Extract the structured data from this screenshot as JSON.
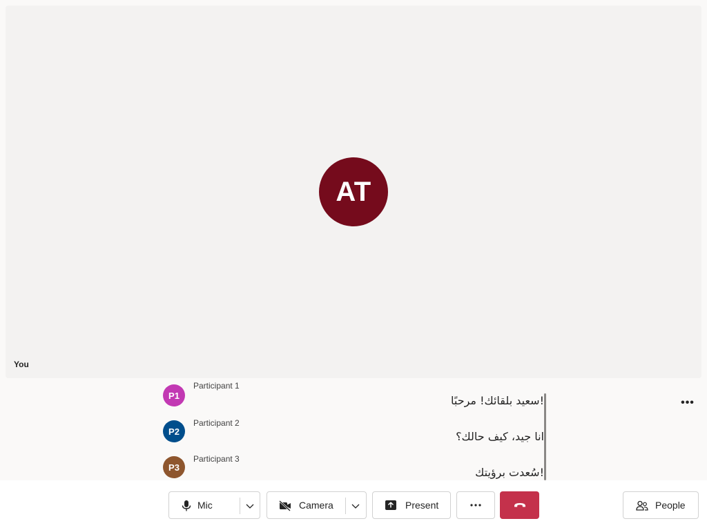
{
  "stage": {
    "avatar_initials": "AT",
    "self_label": "You",
    "avatar_color": "#750b1c"
  },
  "captions": [
    {
      "initials": "P1",
      "name": "Participant 1",
      "text": "!سعيد بلقائك! مرحبًا",
      "color": "#c239b3"
    },
    {
      "initials": "P2",
      "name": "Participant 2",
      "text": "انا جيد، كيف حالك؟",
      "color": "#004e8c"
    },
    {
      "initials": "P3",
      "name": "Participant 3",
      "text": "!سُعدت برؤيتك",
      "color": "#8e562e"
    }
  ],
  "toolbar": {
    "mic_label": "Mic",
    "camera_label": "Camera",
    "present_label": "Present",
    "people_label": "People",
    "more_icon": "more-icon",
    "hangup_color": "#c4314b"
  }
}
